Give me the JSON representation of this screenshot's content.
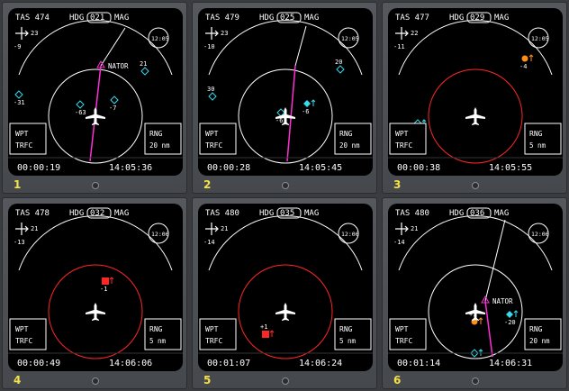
{
  "units_mag": "MAG",
  "labels": {
    "hdg": "HDG",
    "wpt": "WPT",
    "trfc": "TRFC",
    "rng": "RNG"
  },
  "colors": {
    "screen": "#000000",
    "white": "#ffffff",
    "cyan": "#39d8ea",
    "magenta": "#ff2fd6",
    "red": "#ff2626",
    "orange": "#ff8d1a",
    "number": "#f5e14a"
  },
  "panels": [
    {
      "num": "1",
      "tas": "TAS 474",
      "hdg": "021",
      "wind_speed": "23",
      "wind_dir": "-9",
      "clock": "12:05",
      "range": "20 nm",
      "range_circle": "white",
      "elapsed": "00:00:19",
      "time": "14:05:36",
      "waypoint": {
        "name": "NATOR"
      },
      "traffic": [
        {
          "label": "21",
          "color": "cyan",
          "shape": "open-diamond"
        },
        {
          "label": "-31",
          "color": "cyan",
          "shape": "open-diamond"
        },
        {
          "label": "-63",
          "color": "cyan",
          "shape": "open-diamond"
        },
        {
          "label": "-7",
          "color": "cyan",
          "shape": "open-diamond"
        }
      ]
    },
    {
      "num": "2",
      "tas": "TAS 479",
      "hdg": "025",
      "wind_speed": "23",
      "wind_dir": "-10",
      "clock": "12:05",
      "range": "20 nm",
      "range_circle": "white",
      "elapsed": "00:00:28",
      "time": "14:05:45",
      "waypoint": {
        "name": "NATOR"
      },
      "traffic": [
        {
          "label": "20",
          "color": "cyan",
          "shape": "open-diamond"
        },
        {
          "label": "30",
          "color": "cyan",
          "shape": "open-diamond"
        },
        {
          "label": "-61",
          "color": "cyan",
          "shape": "open-diamond"
        },
        {
          "label": "-6",
          "color": "cyan",
          "shape": "filled-diamond"
        }
      ]
    },
    {
      "num": "3",
      "tas": "TAS 477",
      "hdg": "029",
      "wind_speed": "22",
      "wind_dir": "-11",
      "clock": "12:05",
      "range": "5 nm",
      "range_circle": "red",
      "elapsed": "00:00:38",
      "time": "14:05:55",
      "waypoint": null,
      "traffic": [
        {
          "label": "-4",
          "color": "orange",
          "shape": "filled-circle"
        },
        {
          "label": "",
          "color": "cyan",
          "shape": "open-diamond"
        }
      ]
    },
    {
      "num": "4",
      "tas": "TAS 478",
      "hdg": "032",
      "wind_speed": "21",
      "wind_dir": "-13",
      "clock": "12:06",
      "range": "5 nm",
      "range_circle": "red",
      "elapsed": "00:00:49",
      "time": "14:06:06",
      "waypoint": null,
      "traffic": [
        {
          "label": "-1",
          "color": "red",
          "shape": "filled-square"
        }
      ]
    },
    {
      "num": "5",
      "tas": "TAS 480",
      "hdg": "035",
      "wind_speed": "21",
      "wind_dir": "-14",
      "clock": "12:06",
      "range": "5 nm",
      "range_circle": "red",
      "elapsed": "00:01:07",
      "time": "14:06:24",
      "waypoint": null,
      "traffic": [
        {
          "label": "+1",
          "color": "red",
          "shape": "filled-square"
        }
      ]
    },
    {
      "num": "6",
      "tas": "TAS 480",
      "hdg": "036",
      "wind_speed": "21",
      "wind_dir": "-14",
      "clock": "12:06",
      "range": "20 nm",
      "range_circle": "white",
      "elapsed": "00:01:14",
      "time": "14:06:31",
      "waypoint": {
        "name": "NATOR"
      },
      "traffic": [
        {
          "label": "+1",
          "color": "orange",
          "shape": "filled-circle"
        },
        {
          "label": "-20",
          "color": "cyan",
          "shape": "filled-diamond"
        },
        {
          "label": "",
          "color": "cyan",
          "shape": "open-diamond"
        }
      ]
    }
  ]
}
